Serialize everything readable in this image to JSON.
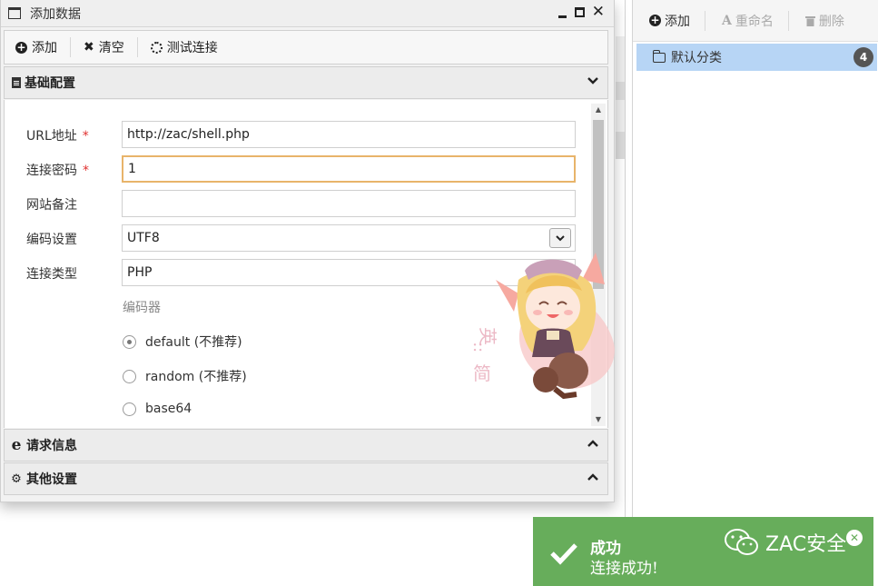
{
  "dialog": {
    "title": "添加数据",
    "controls": {
      "minimize": "minimize",
      "maximize": "maximize",
      "close": "✕"
    }
  },
  "toolbar": {
    "add_label": "添加",
    "clear_label": "清空",
    "test_label": "测试连接"
  },
  "sections": {
    "basic": {
      "title": "基础配置",
      "icon": "file-icon",
      "state": "expanded"
    },
    "request": {
      "title": "请求信息",
      "icon": "ie-icon",
      "state": "collapsed"
    },
    "other": {
      "title": "其他设置",
      "icon": "cogs-icon",
      "state": "collapsed"
    }
  },
  "form": {
    "url": {
      "label": "URL地址",
      "required_mark": "*",
      "value": "http://zac/shell.php"
    },
    "password": {
      "label": "连接密码",
      "required_mark": "*",
      "value": "1"
    },
    "note": {
      "label": "网站备注",
      "value": ""
    },
    "encoding": {
      "label": "编码设置",
      "value": "UTF8"
    },
    "type": {
      "label": "连接类型",
      "value": "PHP"
    },
    "encoder": {
      "title": "编码器",
      "options": [
        "default (不推荐)",
        "random (不推荐)",
        "base64"
      ],
      "selected": "default (不推荐)"
    }
  },
  "right_panel": {
    "toolbar": {
      "add_label": "添加",
      "rename_label": "重命名",
      "delete_label": "删除"
    },
    "categories": [
      {
        "name": "默认分类",
        "count": "4"
      }
    ]
  },
  "toast": {
    "title": "成功",
    "message": "连接成功!",
    "watermark": "ZAC安全"
  },
  "colors": {
    "toast_bg": "#67ad5b",
    "selected_category_bg": "#b7d5f5",
    "required": "#e0302f",
    "focus_border": "#e8b46a"
  }
}
